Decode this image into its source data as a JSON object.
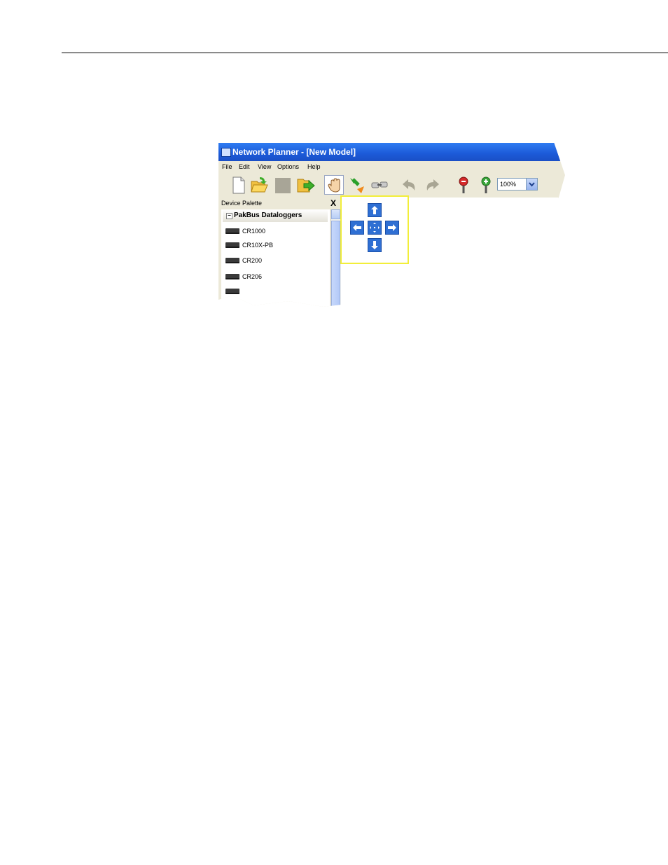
{
  "window": {
    "title": "Network Planner - [New Model]"
  },
  "menu": [
    "File",
    "Edit",
    "View",
    "Options",
    "Help"
  ],
  "toolbar": {
    "zoom_value": "100%",
    "buttons": [
      "new-icon",
      "open-icon",
      "save-icon",
      "export-icon",
      "pan-hand-icon",
      "connect-icon",
      "link-icon",
      "undo-icon",
      "redo-icon",
      "zoom-out-icon",
      "zoom-in-icon"
    ]
  },
  "palette": {
    "title": "Device Palette",
    "close": "X",
    "group": {
      "toggle": "−",
      "label": "PakBus Dataloggers"
    },
    "devices": [
      "CR1000",
      "CR10X-PB",
      "CR200",
      "CR206"
    ]
  },
  "pan_control": {
    "buttons": [
      "pan-up",
      "pan-left",
      "pan-center",
      "pan-right",
      "pan-down"
    ]
  }
}
